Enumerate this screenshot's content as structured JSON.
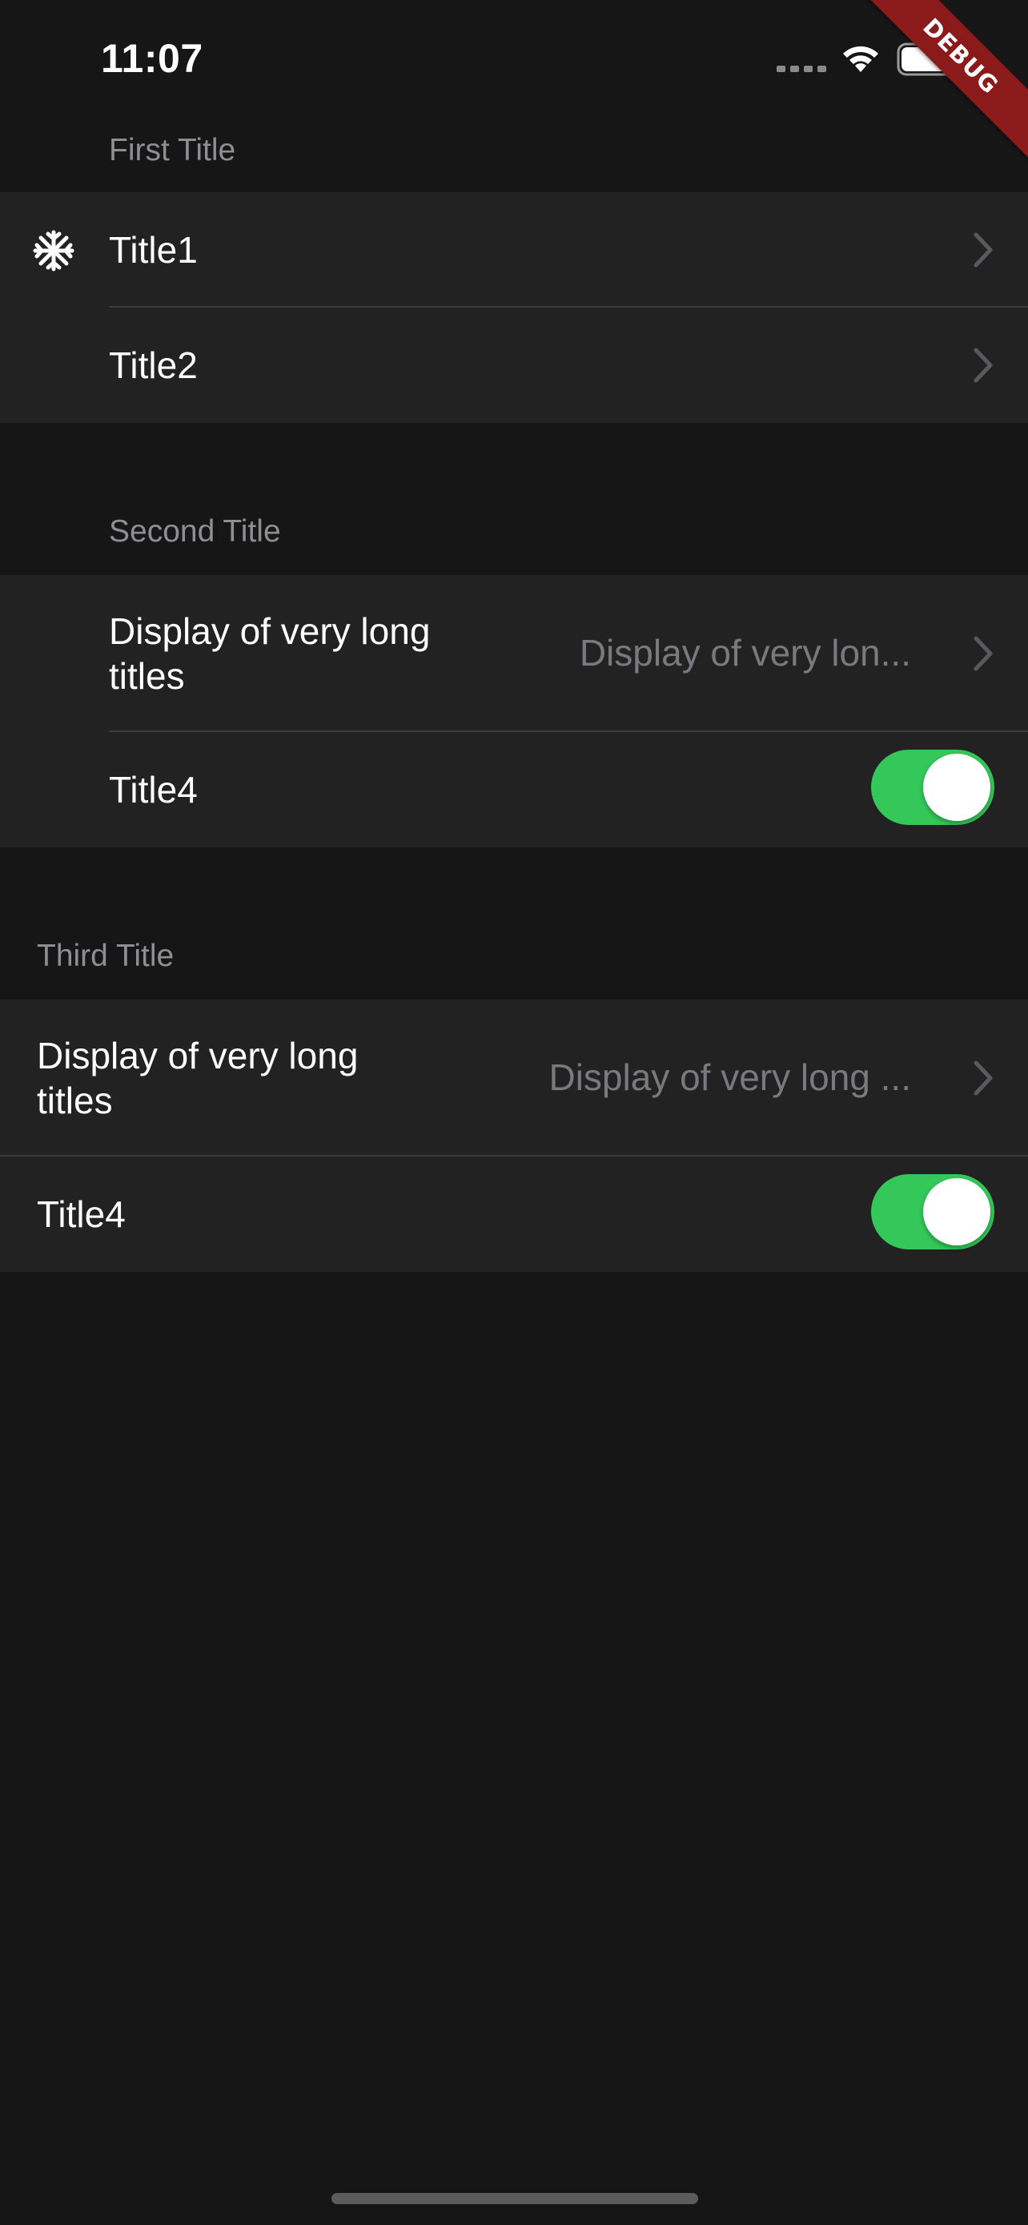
{
  "status_bar": {
    "time": "11:07",
    "icons": [
      "cellular-signal-icon",
      "wifi-icon",
      "battery-icon"
    ]
  },
  "debug_banner": {
    "label": "DEBUG",
    "color": "#8b1a1a"
  },
  "colors": {
    "background": "#161616",
    "cell_background": "#222222",
    "header_text": "#8e8e93",
    "secondary_text": "#7a7a7e",
    "toggle_on": "#34c759"
  },
  "sections": [
    {
      "header": "First Title",
      "rows": [
        {
          "title": "Title1",
          "leading_icon": "snowflake-icon",
          "trailing": "chevron-right-icon"
        },
        {
          "title": "Title2",
          "trailing": "chevron-right-icon"
        }
      ]
    },
    {
      "header": "Second Title",
      "rows": [
        {
          "title": "Display of very long titles",
          "value": "Display of very lon...",
          "trailing": "chevron-right-icon"
        },
        {
          "title": "Title4",
          "toggle": true
        }
      ]
    },
    {
      "header": "Third Title",
      "rows": [
        {
          "title": "Display of very long titles",
          "value": "Display of very long ...",
          "trailing": "chevron-right-icon"
        },
        {
          "title": "Title4",
          "toggle": true
        }
      ]
    }
  ]
}
